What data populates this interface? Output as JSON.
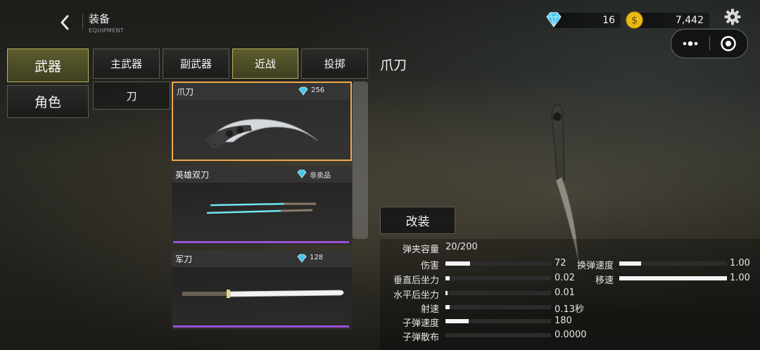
{
  "header": {
    "title": "装备",
    "subtitle": "EQUIPMENT",
    "back_icon": "chevron-left-icon",
    "settings_icon": "gear-icon"
  },
  "currency": {
    "gems": "16",
    "coins": "7,442",
    "gem_icon": "diamond-icon",
    "coin_icon": "dollar-coin-icon",
    "gem_color": "#5fd3f3",
    "coin_color": "#f2c318"
  },
  "capsule": {
    "more_icon": "more-dots-icon",
    "close_icon": "target-circle-icon"
  },
  "left_tabs": [
    {
      "label": "武器",
      "selected": true
    },
    {
      "label": "角色",
      "selected": false
    }
  ],
  "category_tabs": [
    {
      "label": "主武器",
      "selected": false
    },
    {
      "label": "副武器",
      "selected": false
    },
    {
      "label": "近战",
      "selected": true
    },
    {
      "label": "投掷",
      "selected": false
    }
  ],
  "sub_tab": "刀",
  "selected_item_title": "爪刀",
  "items": [
    {
      "name": "爪刀",
      "price": "256",
      "selected": true
    },
    {
      "name": "英雄双刀",
      "price": "非卖品",
      "selected": false,
      "rarity_color": "#9c4fd6"
    },
    {
      "name": "军刀",
      "price": "128",
      "selected": false,
      "rarity_color": "#9c4fd6"
    }
  ],
  "modify_label": "改装",
  "stats": {
    "capacity_label": "弹夹容量",
    "capacity_value": "20/200",
    "left": [
      {
        "label": "伤害",
        "value": "72",
        "fill": 0.23
      },
      {
        "label": "垂直后坐力",
        "value": "0.02",
        "fill": 0.04
      },
      {
        "label": "水平后坐力",
        "value": "0.01",
        "fill": 0.015
      },
      {
        "label": "射速",
        "value": "0.13秒",
        "fill": 0.04
      },
      {
        "label": "子弹速度",
        "value": "180",
        "fill": 0.22
      },
      {
        "label": "子弹散布",
        "value": "0.0000",
        "fill": 0.0
      }
    ],
    "right": [
      {
        "label": "换弹速度",
        "value": "1.00",
        "fill": 0.2
      },
      {
        "label": "移速",
        "value": "1.00",
        "fill": 1.0
      }
    ]
  }
}
